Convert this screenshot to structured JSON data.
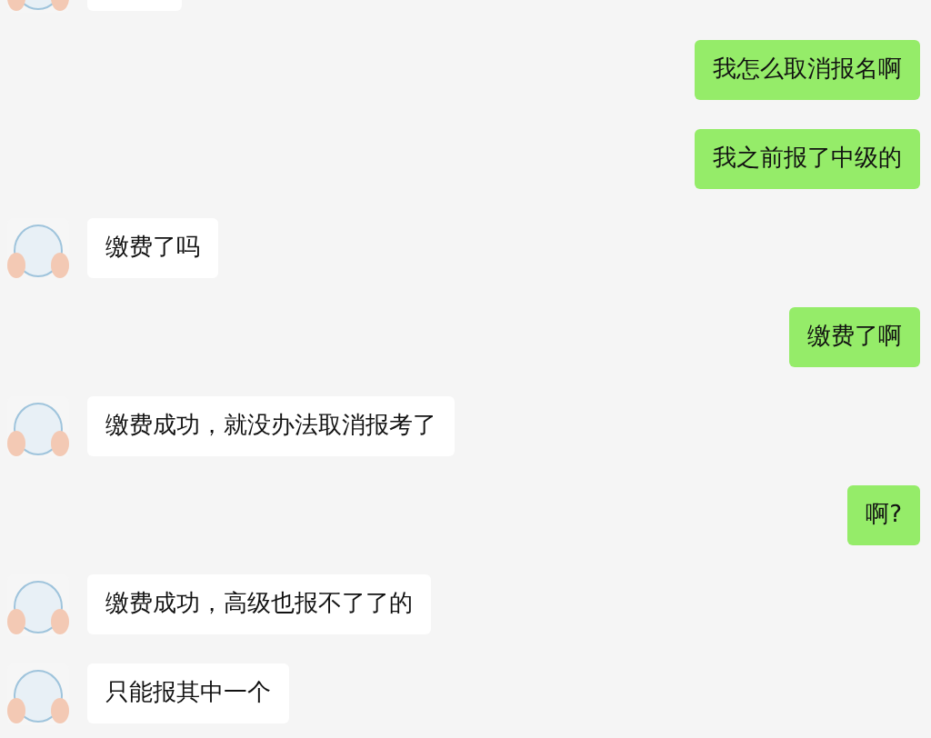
{
  "messages": [
    {
      "kind": "received"
    },
    {
      "kind": "sent",
      "text": "我怎么取消报名啊"
    },
    {
      "kind": "sent",
      "text": "我之前报了中级的"
    },
    {
      "kind": "received",
      "text": "缴费了吗"
    },
    {
      "kind": "sent",
      "text": "缴费了啊"
    },
    {
      "kind": "received",
      "text": "缴费成功，就没办法取消报考了"
    },
    {
      "kind": "sent",
      "text": "啊?"
    },
    {
      "kind": "received",
      "text": "缴费成功，高级也报不了了的"
    },
    {
      "kind": "received",
      "text": "只能报其中一个"
    }
  ]
}
